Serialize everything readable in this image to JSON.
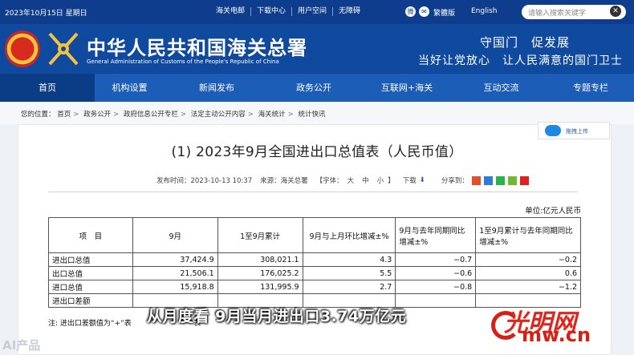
{
  "topbar": {
    "date": "2023年10月15日 星期日",
    "links": [
      "海关电邮",
      "下载中心",
      "用户空间",
      "无障碍"
    ],
    "traditional": "繁體版",
    "english": "English",
    "search_placeholder": "请输入搜索关键字"
  },
  "header": {
    "title": "中华人民共和国海关总署",
    "subtitle": "General Administration of Customs of the People's Republic of China",
    "slogan_line1": "守国门　促发展",
    "slogan_line2": "当好让党放心　让人民满意的国门卫士"
  },
  "nav": {
    "items": [
      "首页",
      "机构设置",
      "新闻发布",
      "政务公开",
      "互联网+海关",
      "互动交流",
      "专题专栏"
    ]
  },
  "breadcrumb": {
    "prefix": "您的位置：",
    "items": [
      "首页",
      "政务公开",
      "政府信息公开专栏",
      "法定主动公开内容",
      "海关统计",
      "统计快讯"
    ]
  },
  "side_button": {
    "label": "拖拽上传"
  },
  "article": {
    "title": "(1) 2023年9月全国进出口总值表（人民币值）",
    "published": "发布时间：2023-10-13 10:37",
    "source": "来源：海关总署",
    "font_label": "【字体：",
    "font_options": [
      "大",
      "中",
      "小"
    ],
    "font_close": "】",
    "download": "下载",
    "share": "分享到：",
    "unit": "单位:亿元人民币"
  },
  "table": {
    "headers": [
      "项　目",
      "9月",
      "1至9月累计",
      "9月与上月环比增减±%",
      "9月与去年同期同比增减±%",
      "1至9月累计与去年同期同比增减±%"
    ],
    "rows": [
      [
        "进出口总值",
        "37,424.9",
        "308,021.1",
        "4.3",
        "−0.7",
        "−0.2"
      ],
      [
        "出口总值",
        "21,506.1",
        "176,025.2",
        "5.5",
        "−0.6",
        "0.6"
      ],
      [
        "进口总值",
        "15,918.8",
        "131,995.9",
        "2.7",
        "−0.8",
        "−1.2"
      ],
      [
        "进出口差额",
        "",
        "",
        "",
        "",
        ""
      ]
    ]
  },
  "note": "注: 进出口差额值为“+”表",
  "note_tail": "”表",
  "overlay": {
    "caption": "从月度看 9月当月进出口3.74万亿元",
    "ai_badge": "AI产品",
    "logo_top": "光明网",
    "logo_bottom": "mw.cn"
  },
  "colors": {
    "topbar": "#0d3d8c",
    "header": "#0f4a9e",
    "nav": "#1c5db8",
    "nav_active": "#0a3d86",
    "logo_red": "#d62015"
  }
}
